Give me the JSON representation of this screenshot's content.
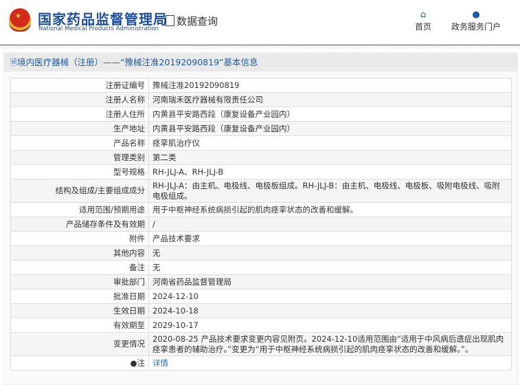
{
  "header": {
    "logo_cn": "国家药品监督管理局",
    "logo_en": "National Medical Products Administration",
    "query_label": "数据查询",
    "nav": [
      {
        "label": "首页",
        "icon": "home-icon"
      },
      {
        "label": "政务服务门户",
        "icon": "user-icon"
      }
    ]
  },
  "panel": {
    "title": "境内医疗器械（注册）——“豫械注准20192090819”基本信息"
  },
  "rows": [
    {
      "label": "注册证编号",
      "value": "豫械注准20192090819"
    },
    {
      "label": "注册人名称",
      "value": "河南瑞禾医疗器械有限责任公司"
    },
    {
      "label": "注册人住所",
      "value": "内黄县平安路西段（康复设备产业园内）"
    },
    {
      "label": "生产地址",
      "value": "内黄县平安路西段（康复设备产业园内）"
    },
    {
      "label": "产品名称",
      "value": "痉挛肌治疗仪"
    },
    {
      "label": "管理类别",
      "value": "第二类"
    },
    {
      "label": "型号规格",
      "value": "RH-JLJ-A、RH-JLJ-B"
    },
    {
      "label": "结构及组成/主要组成成分",
      "value": "RH-JLJ-A：由主机、电极线、电极板组成。RH-JLJ-B：由主机、电极线、电极板、吸附电极线、吸附电极组成。"
    },
    {
      "label": "适用范围/预期用途",
      "value": "用于中枢神经系统病损引起的肌肉痉挛状态的改善和缓解。"
    },
    {
      "label": "产品储存条件及有效期",
      "value": "/"
    },
    {
      "label": "附件",
      "value": "产品技术要求"
    },
    {
      "label": "其他内容",
      "value": "无"
    },
    {
      "label": "备注",
      "value": "无"
    },
    {
      "label": "审批部门",
      "value": "河南省药品监督管理局"
    },
    {
      "label": "批准日期",
      "value": "2024-12-10"
    },
    {
      "label": "生效日期",
      "value": "2024-10-18"
    },
    {
      "label": "有效期至",
      "value": "2029-10-17"
    },
    {
      "label": "变更情况",
      "value": "2020-08-25 产品技术要求变更内容见附页。2024-12-10适用范围由“适用于中风病后遗症出现肌肉痉挛患者的辅助治疗。”变更为“用于中枢神经系统病损引起的肌肉痉挛状态的改善和缓解。”。"
    }
  ],
  "note": {
    "label": "注",
    "link": "详情"
  }
}
